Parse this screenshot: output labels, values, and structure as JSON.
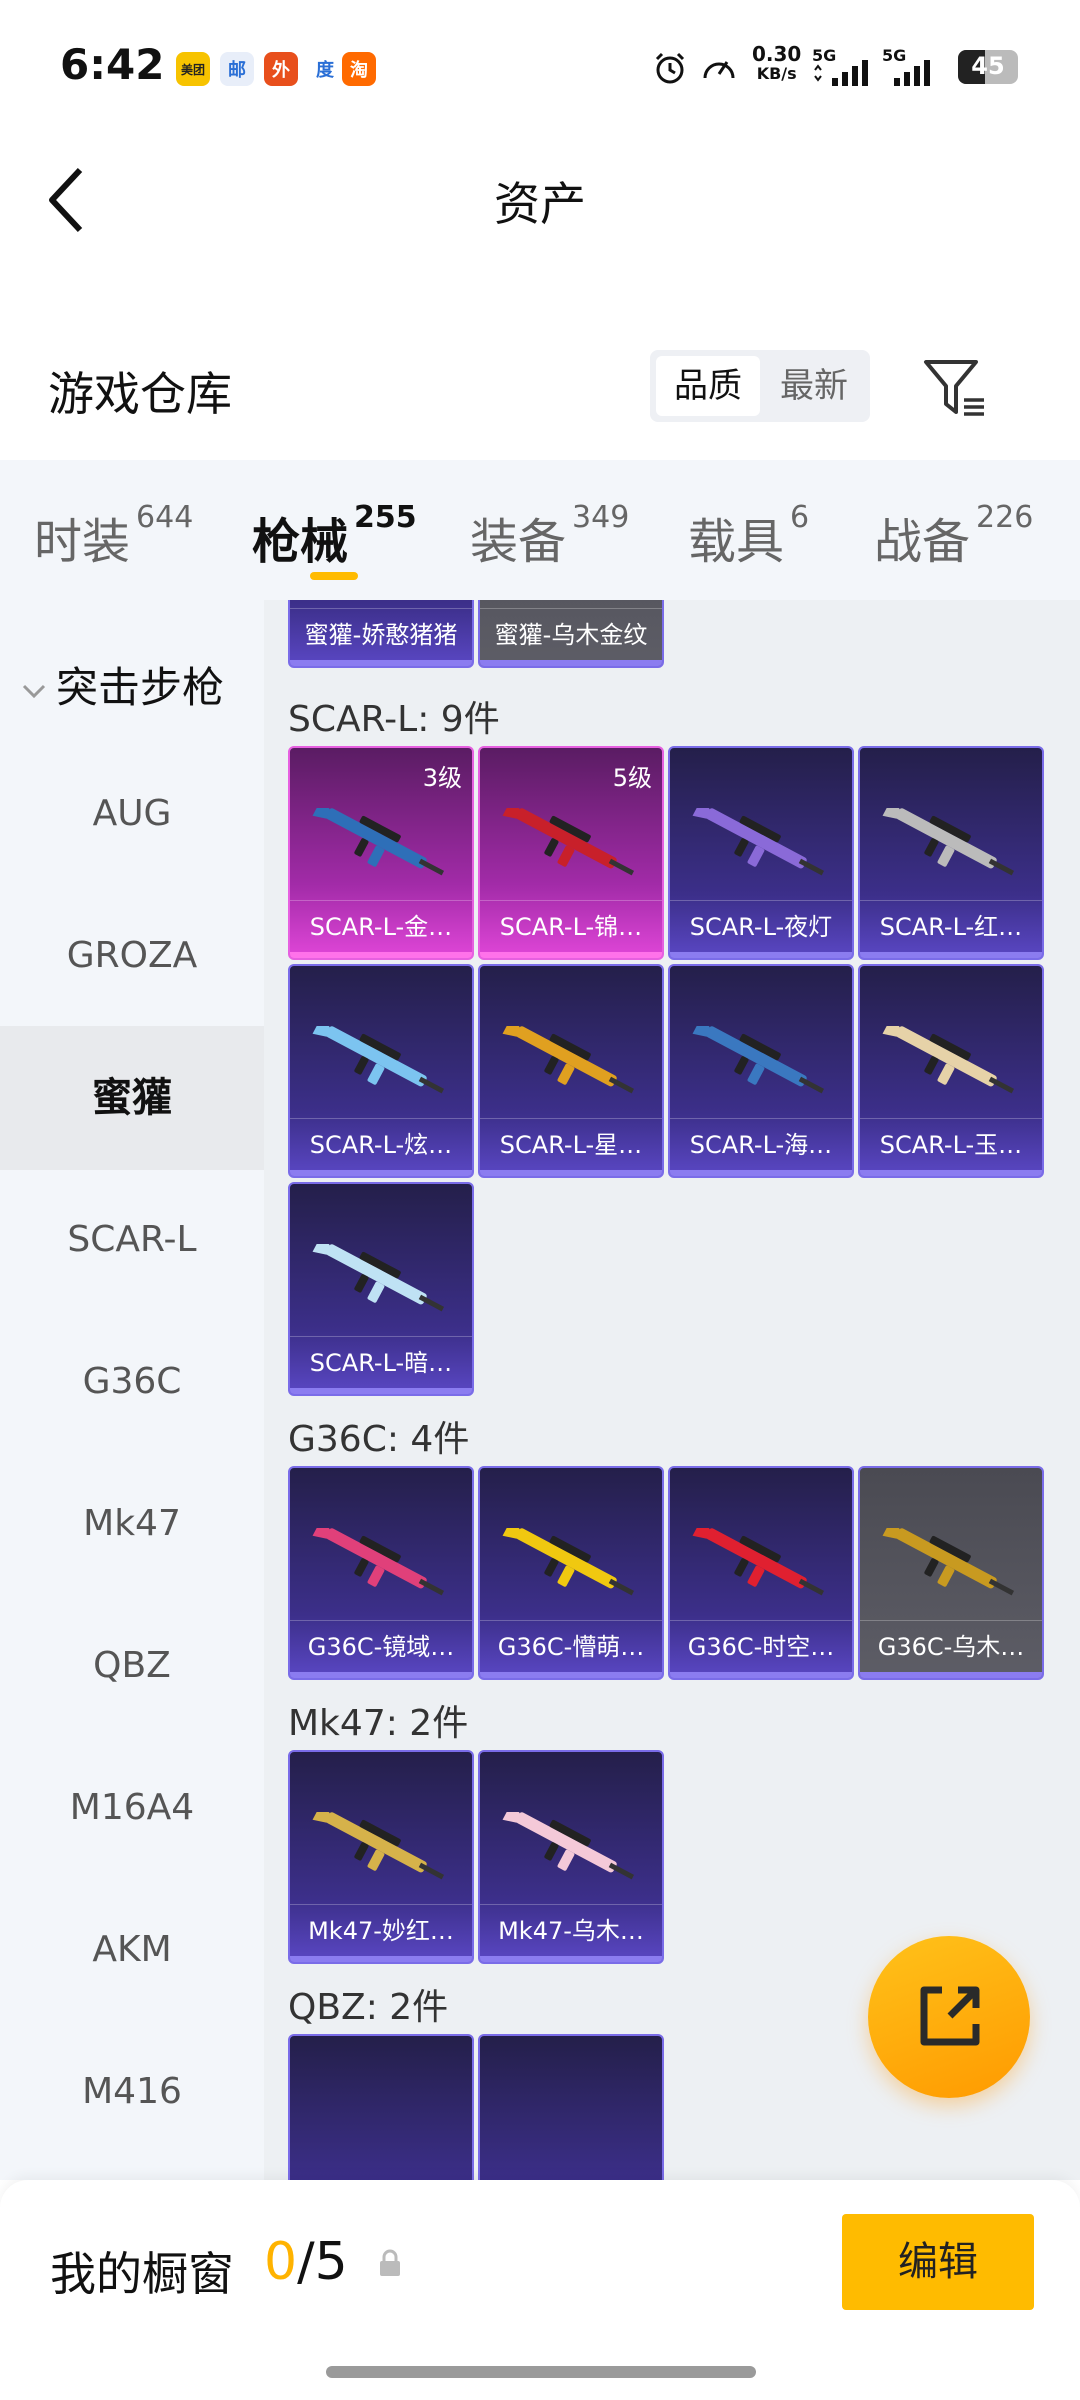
{
  "status_bar": {
    "time": "6:42",
    "apps": [
      "美团",
      "邮",
      "外",
      "度",
      "淘"
    ],
    "net_speed_value": "0.30",
    "net_speed_unit": "KB/s",
    "signal1": "5G",
    "signal2": "5G",
    "battery": "45"
  },
  "header": {
    "title": "资产"
  },
  "warehouse": {
    "title": "游戏仓库",
    "sort_options": [
      "品质",
      "最新"
    ],
    "sort_selected": "品质"
  },
  "tabs": [
    {
      "label": "时装",
      "count": "644"
    },
    {
      "label": "枪械",
      "count": "255"
    },
    {
      "label": "装备",
      "count": "349"
    },
    {
      "label": "载具",
      "count": "6"
    },
    {
      "label": "战备",
      "count": "226"
    }
  ],
  "active_tab": "枪械",
  "sidebar": {
    "category": "突击步枪",
    "items": [
      "AUG",
      "GROZA",
      "蜜獾",
      "SCAR-L",
      "G36C",
      "Mk47",
      "QBZ",
      "M16A4",
      "AKM",
      "M416"
    ],
    "active": "蜜獾"
  },
  "content": {
    "partial_row": [
      {
        "name": "蜜獾-娇憨猪猪",
        "style": "purple"
      },
      {
        "name": "蜜獾-乌木金纹",
        "style": "grey"
      }
    ],
    "groups": [
      {
        "title": "SCAR-L: 9件",
        "items": [
          {
            "name": "SCAR-L-金…",
            "level": "3级",
            "style": "pink"
          },
          {
            "name": "SCAR-L-锦…",
            "level": "5级",
            "style": "pink"
          },
          {
            "name": "SCAR-L-夜灯",
            "level": "",
            "style": "purple"
          },
          {
            "name": "SCAR-L-红…",
            "level": "",
            "style": "purple"
          },
          {
            "name": "SCAR-L-炫…",
            "level": "",
            "style": "purple"
          },
          {
            "name": "SCAR-L-星…",
            "level": "",
            "style": "purple"
          },
          {
            "name": "SCAR-L-海…",
            "level": "",
            "style": "purple"
          },
          {
            "name": "SCAR-L-玉…",
            "level": "",
            "style": "purple"
          },
          {
            "name": "SCAR-L-暗…",
            "level": "",
            "style": "purple"
          }
        ]
      },
      {
        "title": "G36C: 4件",
        "items": [
          {
            "name": "G36C-镜域…",
            "level": "",
            "style": "purple"
          },
          {
            "name": "G36C-懵萌…",
            "level": "",
            "style": "purple"
          },
          {
            "name": "G36C-时空…",
            "level": "",
            "style": "purple"
          },
          {
            "name": "G36C-乌木…",
            "level": "",
            "style": "grey"
          }
        ]
      },
      {
        "title": "Mk47: 2件",
        "items": [
          {
            "name": "Mk47-妙红…",
            "level": "",
            "style": "purple"
          },
          {
            "name": "Mk47-乌木…",
            "level": "",
            "style": "purple"
          }
        ]
      },
      {
        "title": "QBZ: 2件",
        "items": []
      }
    ]
  },
  "gun_colors": [
    "#d6b24a",
    "#f4c9d8",
    "#2e6fb8",
    "#c8202a",
    "#8a6ad8",
    "#bbbbbb",
    "#7cc4f0",
    "#e0a020",
    "#3a78c0",
    "#e6d2a8",
    "#bfe2f4",
    "#e0407a",
    "#f0c810",
    "#e02030",
    "#c89a20"
  ],
  "bottom_bar": {
    "showcase_label": "我的橱窗",
    "showcase_current": "0",
    "showcase_total": "/5",
    "edit_label": "编辑"
  }
}
